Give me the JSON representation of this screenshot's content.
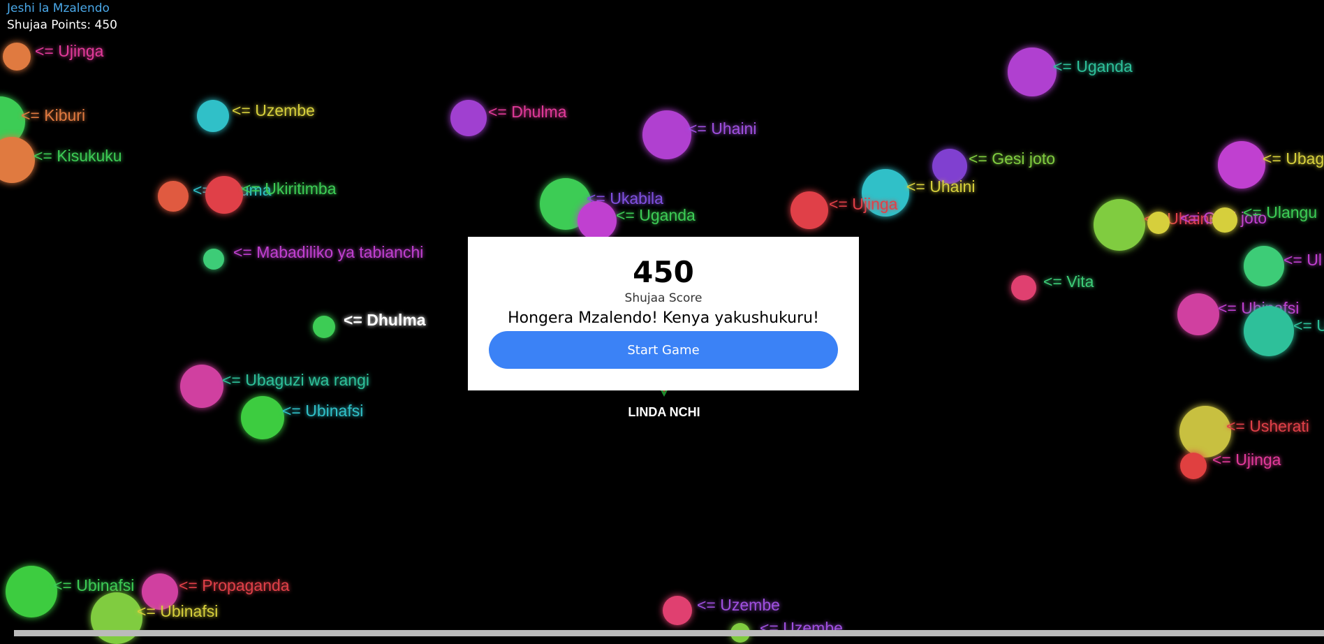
{
  "app": {
    "title": "Jeshi la Mzalendo",
    "points_label": "Shujaa Points: 450"
  },
  "modal": {
    "score": "450",
    "score_label": "Shujaa Score",
    "message": "Hongera Mzalendo! Kenya yakushukuru!",
    "start_button": "Start Game"
  },
  "emblem": {
    "text": "LINDA  NCHI"
  },
  "colors": {
    "background": "#000000",
    "title": "#4aa8e8",
    "button": "#3b82f6",
    "modal": "#ffffff"
  },
  "targets": [
    {
      "word": "<= Ujinga",
      "ball": "#e07a40",
      "text": "#e23a9a"
    },
    {
      "word": "<= Kiburi",
      "ball": "#3dcc55",
      "text": "#e07a40"
    },
    {
      "word": "<= Kisukuku",
      "ball": "#e07a40",
      "text": "#3dcc55"
    },
    {
      "word": "<= Uzembe",
      "ball": "#30c0c8",
      "text": "#d6cf3c"
    },
    {
      "word": "<= Hujuma",
      "ball": "#e05a40",
      "text": "#30c0c8"
    },
    {
      "word": "<= Ukiritimba",
      "ball": "#e04048",
      "text": "#3dcc55"
    },
    {
      "word": "<= Mabadiliko ya tabianchi",
      "ball": "#3dcc77",
      "text": "#c040d0"
    },
    {
      "word": "<= Dhulma",
      "ball": "#3dcc55",
      "text": "#ffffff"
    },
    {
      "word": "<= Ubaguzi wa rangi",
      "ball": "#d040a0",
      "text": "#2ec09a"
    },
    {
      "word": "<= Ubinafsi",
      "ball": "#3dcc40",
      "text": "#30c0c8"
    },
    {
      "word": "<= Ubinafsi",
      "ball": "#3dcc40",
      "text": "#3dcc55"
    },
    {
      "word": "<= Propaganda",
      "ball": "#d040a0",
      "text": "#e04048"
    },
    {
      "word": "<= Ubinafsi",
      "ball": "#80cc40",
      "text": "#d6cf3c"
    },
    {
      "word": "<= Dhulma",
      "ball": "#a040d0",
      "text": "#e23a9a"
    },
    {
      "word": "<= Uhaini",
      "ball": "#b040d0",
      "text": "#a050e0"
    },
    {
      "word": "<= Ukabila",
      "ball": "#3dcc55",
      "text": "#8050e0"
    },
    {
      "word": "<= Uganda",
      "ball": "#c040d0",
      "text": "#3dcc55"
    },
    {
      "word": "<= Uganda",
      "ball": "#b040d0",
      "text": "#2ec09a"
    },
    {
      "word": "<= Gesi joto",
      "ball": "#8040d0",
      "text": "#80cc40"
    },
    {
      "word": "<= Uhaini",
      "ball": "#30c0c8",
      "text": "#d6cf3c"
    },
    {
      "word": "<= Ujinga",
      "ball": "#e04048",
      "text": "#e04048"
    },
    {
      "word": "<= Ubag",
      "ball": "#c040d0",
      "text": "#d6cf3c"
    },
    {
      "word": "<= Uhaini",
      "ball": "#80cc40",
      "text": "#e04048"
    },
    {
      "word": "<= Gesi joto",
      "ball": "#d6cf3c",
      "text": "#c040d0"
    },
    {
      "word": "<= Ulangu",
      "ball": "#d6cf3c",
      "text": "#3dcc55"
    },
    {
      "word": "<= Ul",
      "ball": "#3dcc77",
      "text": "#c040d0"
    },
    {
      "word": "<= Vita",
      "ball": "#e04070",
      "text": "#3dcc77"
    },
    {
      "word": "<= Ubinafsi",
      "ball": "#d040a0",
      "text": "#c040d0"
    },
    {
      "word": "<= U",
      "ball": "#2ec09a",
      "text": "#2ec09a"
    },
    {
      "word": "<= Usherati",
      "ball": "#c8c040",
      "text": "#e04048"
    },
    {
      "word": "<= Ujinga",
      "ball": "#e04040",
      "text": "#e23a9a"
    },
    {
      "word": "<= Uzembe",
      "ball": "#e04070",
      "text": "#a050e0"
    },
    {
      "word": "<= Uzembe",
      "ball": "#80cc40",
      "text": "#a050e0"
    }
  ]
}
